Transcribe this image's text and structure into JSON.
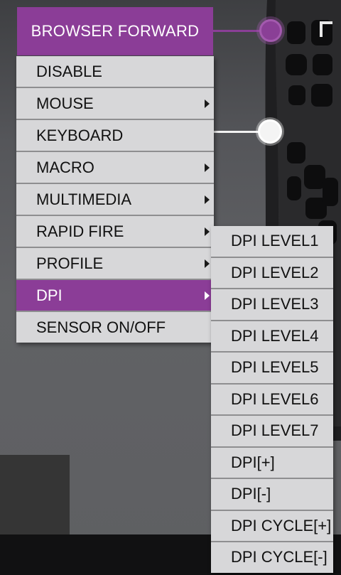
{
  "colors": {
    "accent": "#8b3d97",
    "menu_bg": "#d7d7d9",
    "divider": "#8e8e90"
  },
  "header": {
    "label": "BROWSER FORWARD"
  },
  "menu": {
    "items": [
      {
        "label": "DISABLE",
        "submenu": false,
        "active": false
      },
      {
        "label": "MOUSE",
        "submenu": true,
        "active": false
      },
      {
        "label": "KEYBOARD",
        "submenu": false,
        "active": false
      },
      {
        "label": "MACRO",
        "submenu": true,
        "active": false
      },
      {
        "label": "MULTIMEDIA",
        "submenu": true,
        "active": false
      },
      {
        "label": "RAPID FIRE",
        "submenu": true,
        "active": false
      },
      {
        "label": "PROFILE",
        "submenu": true,
        "active": false
      },
      {
        "label": "DPI",
        "submenu": true,
        "active": true
      },
      {
        "label": "SENSOR ON/OFF",
        "submenu": false,
        "active": false
      }
    ]
  },
  "dpi_submenu": {
    "items": [
      "DPI LEVEL1",
      "DPI LEVEL2",
      "DPI LEVEL3",
      "DPI LEVEL4",
      "DPI LEVEL5",
      "DPI LEVEL6",
      "DPI LEVEL7",
      "DPI[+]",
      "DPI[-]",
      "DPI CYCLE[+]",
      "DPI CYCLE[-]"
    ]
  }
}
